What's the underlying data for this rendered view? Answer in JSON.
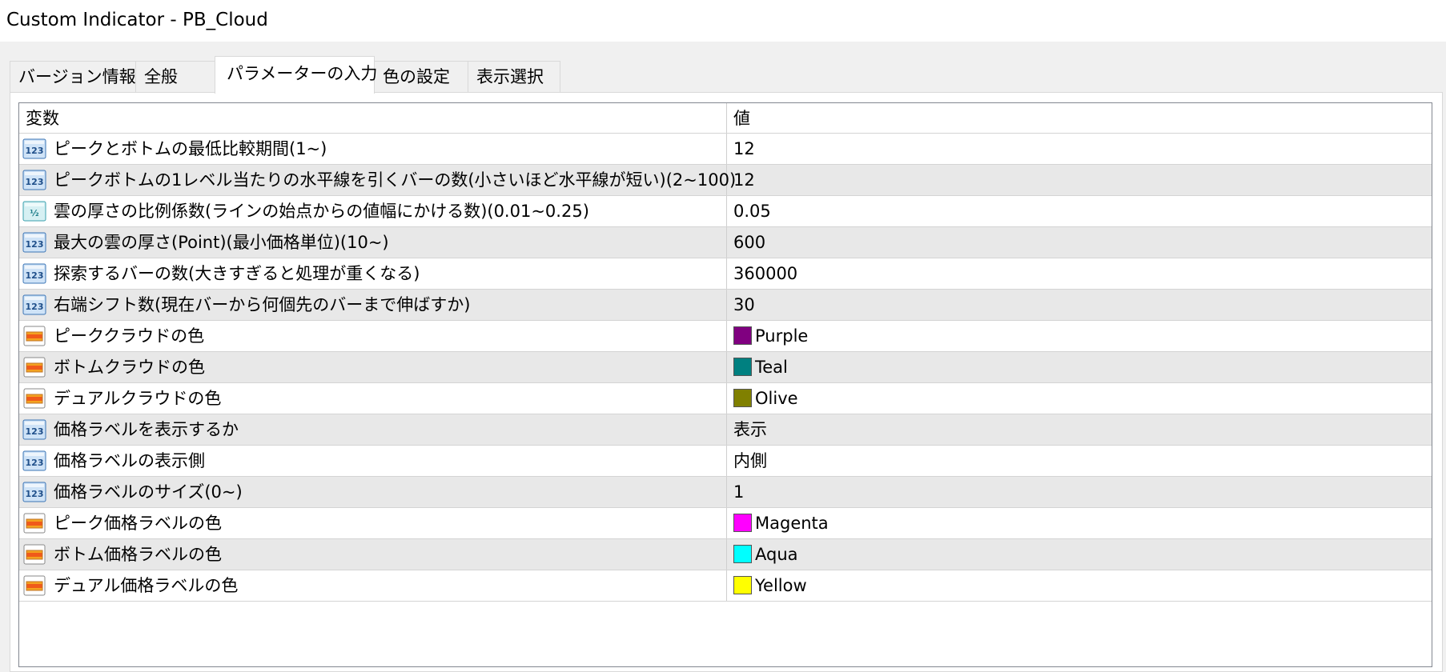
{
  "window": {
    "title": "Custom Indicator - PB_Cloud"
  },
  "tabs": [
    {
      "label": "バージョン情報",
      "active": false
    },
    {
      "label": "全般",
      "active": false
    },
    {
      "label": "パラメーターの入力",
      "active": true
    },
    {
      "label": "色の設定",
      "active": false
    },
    {
      "label": "表示選択",
      "active": false
    }
  ],
  "table": {
    "headers": {
      "name": "変数",
      "value": "値"
    },
    "rows": [
      {
        "icon": "integer-icon",
        "name": "ピークとボトムの最低比較期間(1~)",
        "value": "12"
      },
      {
        "icon": "integer-icon",
        "name": "ピークボトムの1レベル当たりの水平線を引くバーの数(小さいほど水平線が短い)(2~100)",
        "value": "12"
      },
      {
        "icon": "double-icon",
        "name": "雲の厚さの比例係数(ラインの始点からの値幅にかける数)(0.01~0.25)",
        "value": "0.05"
      },
      {
        "icon": "integer-icon",
        "name": "最大の雲の厚さ(Point)(最小価格単位)(10~)",
        "value": "600"
      },
      {
        "icon": "integer-icon",
        "name": "探索するバーの数(大きすぎると処理が重くなる)",
        "value": "360000"
      },
      {
        "icon": "integer-icon",
        "name": "右端シフト数(現在バーから何個先のバーまで伸ばすか)",
        "value": "30"
      },
      {
        "icon": "color-icon",
        "name": "ピーククラウドの色",
        "value": "Purple",
        "swatch": "#800080"
      },
      {
        "icon": "color-icon",
        "name": "ボトムクラウドの色",
        "value": "Teal",
        "swatch": "#008080"
      },
      {
        "icon": "color-icon",
        "name": "デュアルクラウドの色",
        "value": "Olive",
        "swatch": "#808000"
      },
      {
        "icon": "integer-icon",
        "name": "価格ラベルを表示するか",
        "value": "表示"
      },
      {
        "icon": "integer-icon",
        "name": "価格ラベルの表示側",
        "value": "内側"
      },
      {
        "icon": "integer-icon",
        "name": "価格ラベルのサイズ(0~)",
        "value": "1"
      },
      {
        "icon": "color-icon",
        "name": "ピーク価格ラベルの色",
        "value": "Magenta",
        "swatch": "#ff00ff"
      },
      {
        "icon": "color-icon",
        "name": "ボトム価格ラベルの色",
        "value": "Aqua",
        "swatch": "#00ffff"
      },
      {
        "icon": "color-icon",
        "name": "デュアル価格ラベルの色",
        "value": "Yellow",
        "swatch": "#ffff00"
      }
    ]
  }
}
